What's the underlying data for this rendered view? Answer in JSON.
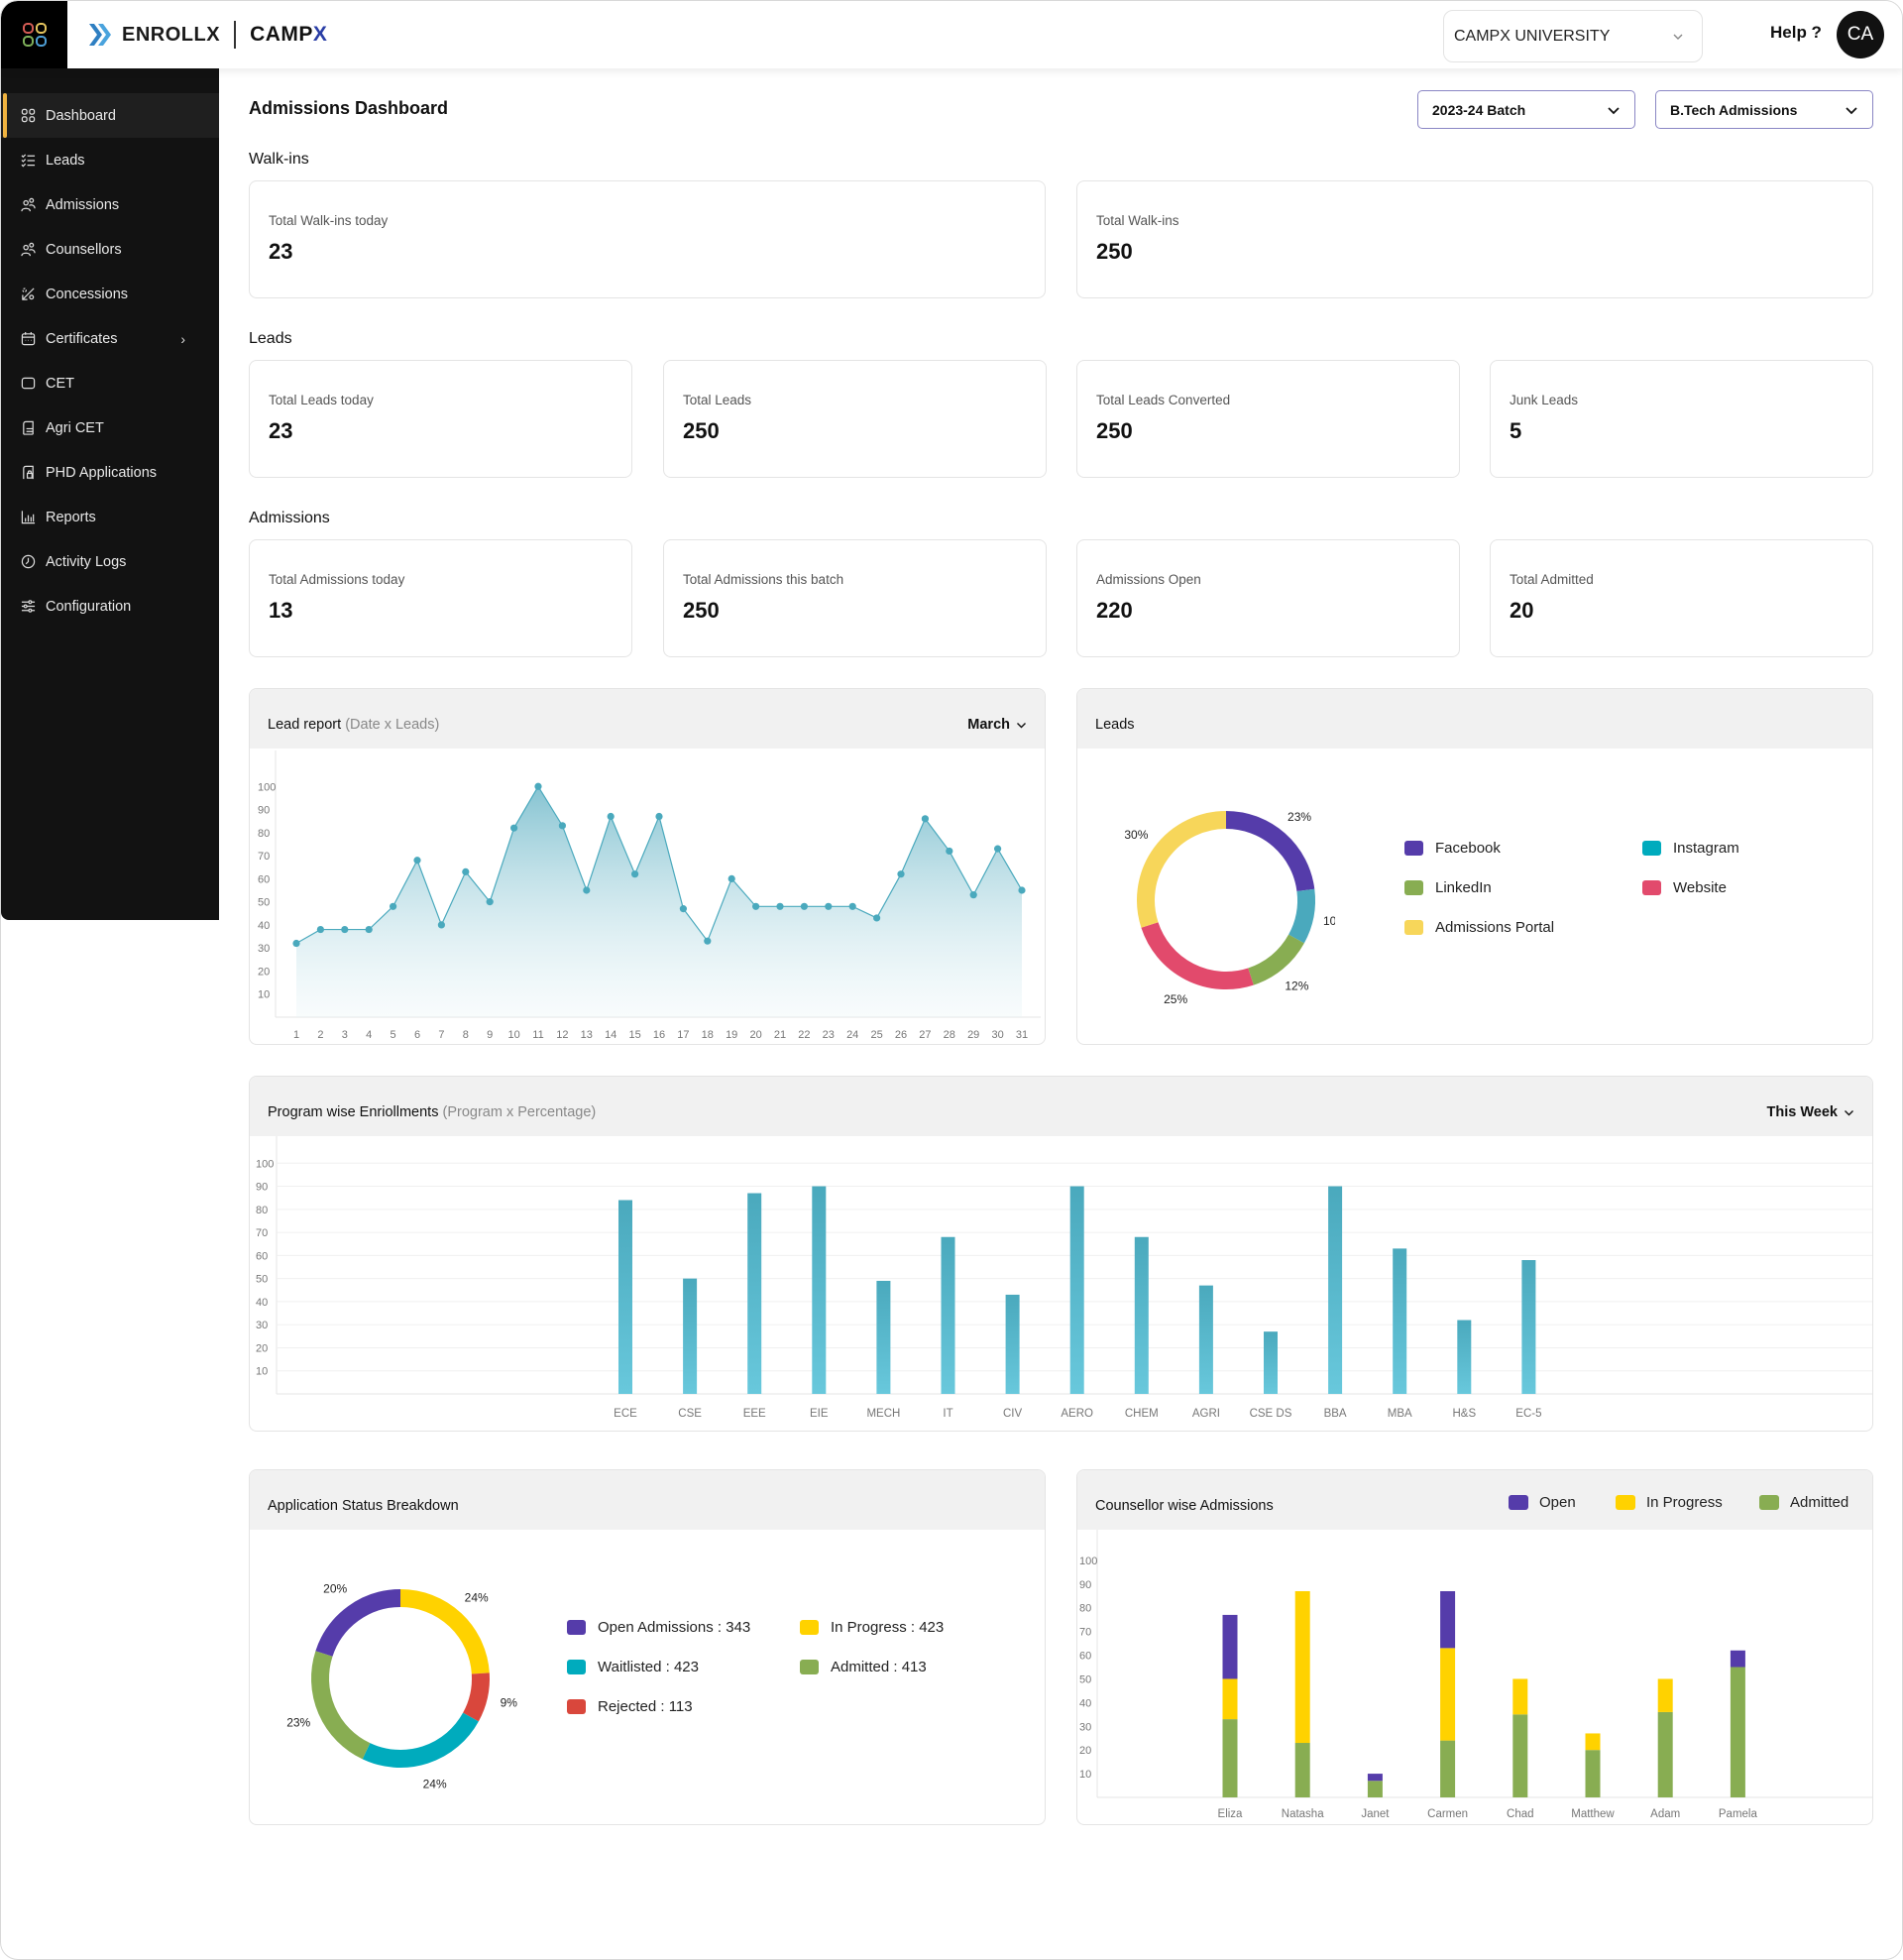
{
  "header": {
    "brand_primary": "ENROLLX",
    "brand_secondary_main": "CAMP",
    "brand_secondary_x": "X",
    "university_select": "CAMPX UNIVERSITY",
    "help_label": "Help ?",
    "avatar_initials": "CA"
  },
  "sidebar": {
    "items": [
      {
        "label": "Dashboard",
        "icon": "grid-icon",
        "active": true
      },
      {
        "label": "Leads",
        "icon": "checklist-icon"
      },
      {
        "label": "Admissions",
        "icon": "users-icon"
      },
      {
        "label": "Counsellors",
        "icon": "users-icon"
      },
      {
        "label": "Concessions",
        "icon": "percent-icon"
      },
      {
        "label": "Certificates",
        "icon": "calendar-icon",
        "has_submenu": true
      },
      {
        "label": "CET",
        "icon": "square-icon"
      },
      {
        "label": "Agri CET",
        "icon": "document-icon"
      },
      {
        "label": "PHD Applications",
        "icon": "document-lock-icon"
      },
      {
        "label": "Reports",
        "icon": "bar-chart-icon"
      },
      {
        "label": "Activity Logs",
        "icon": "clock-icon"
      },
      {
        "label": "Configuration",
        "icon": "sliders-icon"
      }
    ]
  },
  "page": {
    "title": "Admissions Dashboard",
    "batch_select": "2023-24 Batch",
    "program_select": "B.Tech Admissions"
  },
  "walkins": {
    "section": "Walk-ins",
    "cards": [
      {
        "label": "Total Walk-ins today",
        "value": "23"
      },
      {
        "label": "Total Walk-ins",
        "value": "250"
      }
    ]
  },
  "leads": {
    "section": "Leads",
    "cards": [
      {
        "label": "Total Leads today",
        "value": "23"
      },
      {
        "label": "Total Leads",
        "value": "250"
      },
      {
        "label": "Total Leads Converted",
        "value": "250"
      },
      {
        "label": "Junk Leads",
        "value": "5"
      }
    ]
  },
  "admissions": {
    "section": "Admissions",
    "cards": [
      {
        "label": "Total Admissions today",
        "value": "13"
      },
      {
        "label": "Total Admissions this batch",
        "value": "250"
      },
      {
        "label": "Admissions Open",
        "value": "220"
      },
      {
        "label": "Total Admitted",
        "value": "20"
      }
    ]
  },
  "panels": {
    "lead_report": {
      "title": "Lead report",
      "subtitle": "(Date x Leads)",
      "control": "March"
    },
    "leads_source": {
      "title": "Leads"
    },
    "program": {
      "title": "Program wise Enriollments",
      "subtitle": "(Program x Percentage)",
      "control": "This Week"
    },
    "app_status": {
      "title": "Application Status Breakdown"
    },
    "counsellor": {
      "title": "Counsellor wise Admissions"
    }
  },
  "colors": {
    "accent_teal": "#4aa9bd",
    "purple": "#553caa",
    "yellow": "#ffd200",
    "green": "#88ad52",
    "teal": "#00abbd",
    "red": "#d9473c",
    "pink": "#e24a6c",
    "portal_yellow": "#f7d65a",
    "active_nav": "#f0b340"
  },
  "chart_data": [
    {
      "id": "lead_report",
      "type": "area",
      "title": "Lead report (Date x Leads)",
      "xlabel": "Date",
      "ylabel": "Leads",
      "x": [
        1,
        2,
        3,
        4,
        5,
        6,
        7,
        8,
        9,
        10,
        11,
        12,
        13,
        14,
        15,
        16,
        17,
        18,
        19,
        20,
        21,
        22,
        23,
        24,
        25,
        26,
        27,
        28,
        29,
        30,
        31
      ],
      "values": [
        32,
        38,
        38,
        38,
        48,
        68,
        40,
        63,
        50,
        82,
        100,
        83,
        55,
        87,
        62,
        87,
        47,
        33,
        60,
        48,
        48,
        48,
        48,
        48,
        43,
        62,
        86,
        72,
        53,
        73,
        55
      ],
      "yticks": [
        10,
        20,
        30,
        40,
        50,
        60,
        70,
        80,
        90,
        100
      ],
      "ylim": [
        0,
        110
      ],
      "grid": false
    },
    {
      "id": "leads_source",
      "type": "pie",
      "title": "Leads",
      "slices": [
        {
          "label": "Facebook",
          "value": 23,
          "color": "#553caa"
        },
        {
          "label": "Instagram",
          "value": 10,
          "color": "#4aa9bd"
        },
        {
          "label": "LinkedIn",
          "value": 12,
          "color": "#88ad52"
        },
        {
          "label": "Website",
          "value": 25,
          "color": "#e24a6c"
        },
        {
          "label": "Admissions Portal",
          "value": 30,
          "color": "#f7d65a"
        }
      ],
      "legend": [
        {
          "label": "Facebook",
          "color": "#553caa"
        },
        {
          "label": "Instagram",
          "color": "#00abbd"
        },
        {
          "label": "LinkedIn",
          "color": "#88ad52"
        },
        {
          "label": "Website",
          "color": "#e24a6c"
        },
        {
          "label": "Admissions Portal",
          "color": "#f7d65a"
        }
      ],
      "legend_position": "right"
    },
    {
      "id": "program",
      "type": "bar",
      "title": "Program wise Enriollments (Program x Percentage)",
      "categories": [
        "ECE",
        "CSE",
        "EEE",
        "EIE",
        "MECH",
        "IT",
        "CIV",
        "AERO",
        "CHEM",
        "AGRI",
        "CSE DS",
        "BBA",
        "MBA",
        "H&S",
        "EC-5"
      ],
      "values": [
        84,
        50,
        87,
        90,
        49,
        68,
        43,
        90,
        68,
        47,
        27,
        90,
        63,
        32,
        58
      ],
      "yticks": [
        10,
        20,
        30,
        40,
        50,
        60,
        70,
        80,
        90,
        100
      ],
      "ylim": [
        0,
        110
      ],
      "grid": true
    },
    {
      "id": "app_status",
      "type": "pie",
      "title": "Application Status Breakdown",
      "slices": [
        {
          "label": "In Progress",
          "value": 24,
          "color": "#ffd200"
        },
        {
          "label": "Rejected",
          "value": 9,
          "color": "#d9473c"
        },
        {
          "label": "Waitlisted",
          "value": 24,
          "color": "#00abbd"
        },
        {
          "label": "Admitted",
          "value": 23,
          "color": "#88ad52"
        },
        {
          "label": "Open Admissions",
          "value": 20,
          "color": "#553caa"
        }
      ],
      "legend": [
        {
          "label": "Open Admissions : 343",
          "color": "#553caa"
        },
        {
          "label": "In Progress : 423",
          "color": "#ffd200"
        },
        {
          "label": "Waitlisted : 423",
          "color": "#00abbd"
        },
        {
          "label": "Admitted : 413",
          "color": "#88ad52"
        },
        {
          "label": "Rejected : 113",
          "color": "#d9473c"
        }
      ],
      "legend_position": "right"
    },
    {
      "id": "counsellor",
      "type": "bar",
      "stacked": true,
      "title": "Counsellor wise Admissions",
      "categories": [
        "Eliza",
        "Natasha",
        "Janet",
        "Carmen",
        "Chad",
        "Matthew",
        "Adam",
        "Pamela"
      ],
      "series": [
        {
          "name": "Admitted",
          "color": "#88ad52",
          "values": [
            33,
            23,
            7,
            24,
            35,
            20,
            36,
            55
          ]
        },
        {
          "name": "In Progress",
          "color": "#ffd200",
          "values": [
            17,
            64,
            0,
            39,
            15,
            7,
            14,
            0
          ]
        },
        {
          "name": "Open",
          "color": "#553caa",
          "values": [
            27,
            0,
            3,
            24,
            0,
            0,
            0,
            7
          ]
        }
      ],
      "legend": [
        "Open",
        "In Progress",
        "Admitted"
      ],
      "legend_position": "top-right",
      "yticks": [
        10,
        20,
        30,
        40,
        50,
        60,
        70,
        80,
        90,
        100
      ],
      "ylim": [
        0,
        110
      ]
    }
  ]
}
